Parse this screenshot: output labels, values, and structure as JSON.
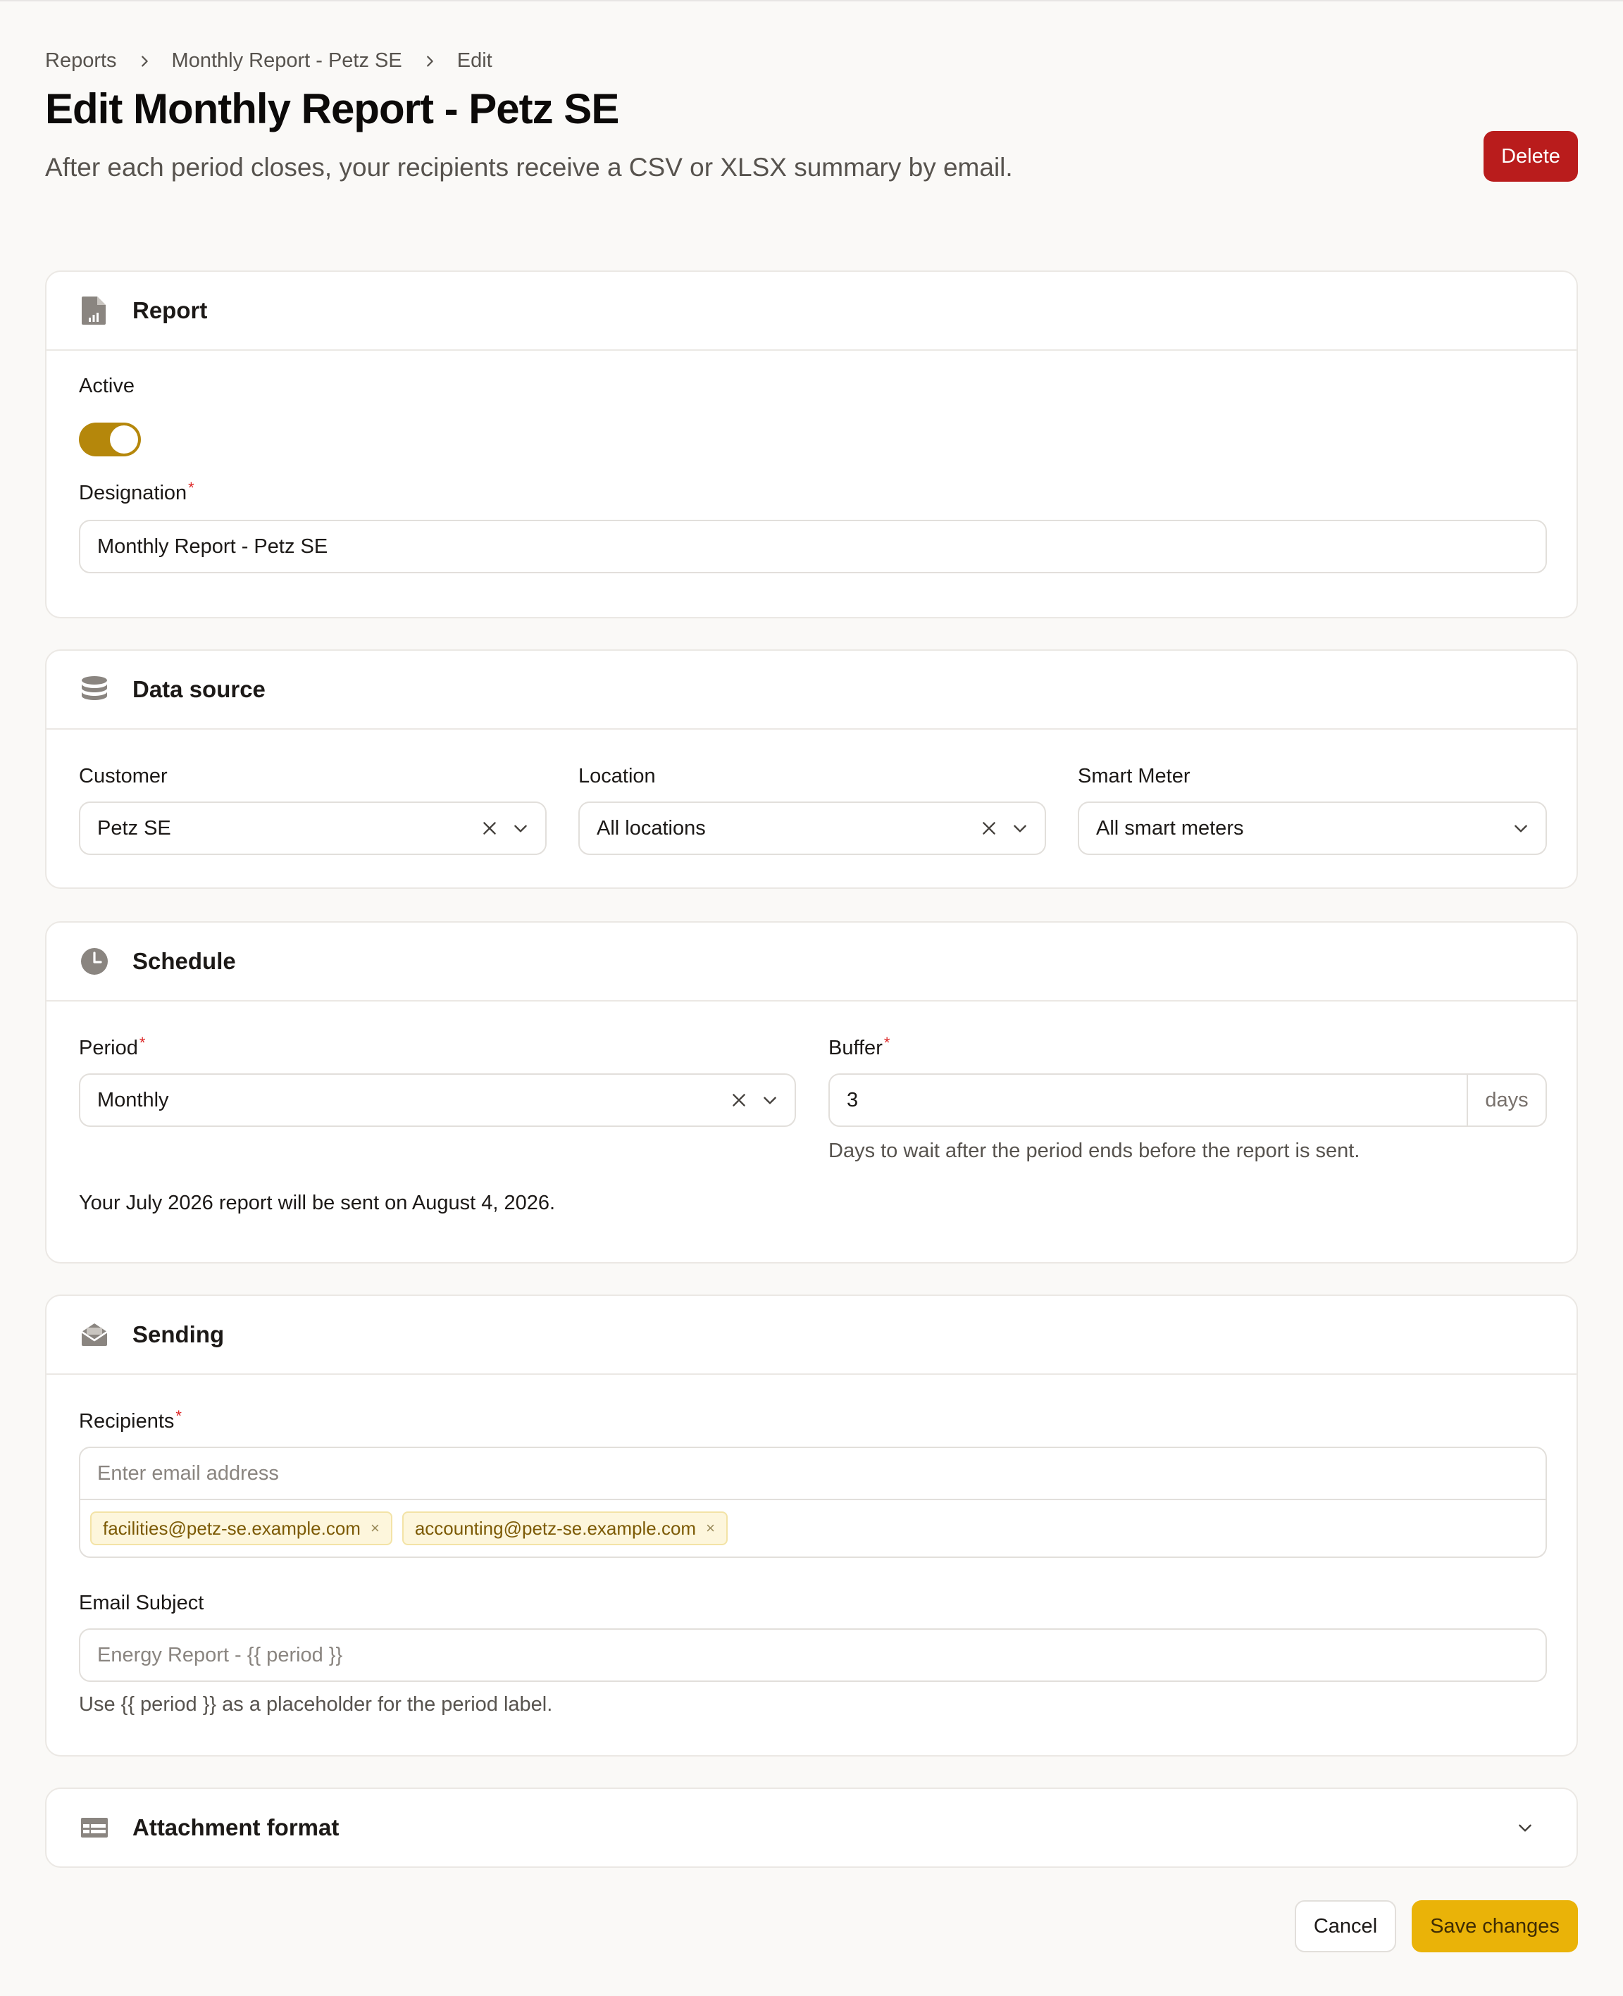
{
  "breadcrumb": {
    "items": [
      "Reports",
      "Monthly Report - Petz SE",
      "Edit"
    ]
  },
  "header": {
    "title": "Edit Monthly Report - Petz SE",
    "subtitle": "After each period closes, your recipients receive a CSV or XLSX summary by email.",
    "delete_label": "Delete"
  },
  "report": {
    "title": "Report",
    "active_label": "Active",
    "active": true,
    "designation_label": "Designation",
    "required_mark": "*",
    "designation_value": "Monthly Report - Petz SE"
  },
  "data_source": {
    "title": "Data source",
    "customer_label": "Customer",
    "customer_value": "Petz SE",
    "location_label": "Location",
    "location_value": "All locations",
    "smart_meter_label": "Smart Meter",
    "smart_meter_value": "All smart meters"
  },
  "schedule": {
    "title": "Schedule",
    "period_label": "Period",
    "period_value": "Monthly",
    "buffer_label": "Buffer",
    "buffer_value": "3",
    "buffer_unit": "days",
    "buffer_help": "Days to wait after the period ends before the report is sent.",
    "send_info": "Your July 2026 report will be sent on August 4, 2026."
  },
  "sending": {
    "title": "Sending",
    "recipients_label": "Recipients",
    "recipients_placeholder": "Enter email address",
    "recipients": [
      "facilities@petz-se.example.com",
      "accounting@petz-se.example.com"
    ],
    "chip_remove": "×",
    "subject_label": "Email Subject",
    "subject_placeholder": "Energy Report - {{ period }}",
    "subject_help": "Use {{ period }} as a placeholder for the period label."
  },
  "attachment": {
    "title": "Attachment format"
  },
  "footer": {
    "cancel_label": "Cancel",
    "save_label": "Save changes"
  },
  "colors": {
    "accent": "#eab308",
    "toggle": "#b5870b",
    "danger": "#b91c1c",
    "required": "#dc2626"
  },
  "icons": [
    "chevron-right-icon",
    "report-icon",
    "database-icon",
    "clock-icon",
    "mail-icon",
    "table-icon",
    "close-icon",
    "chevron-down-icon"
  ]
}
